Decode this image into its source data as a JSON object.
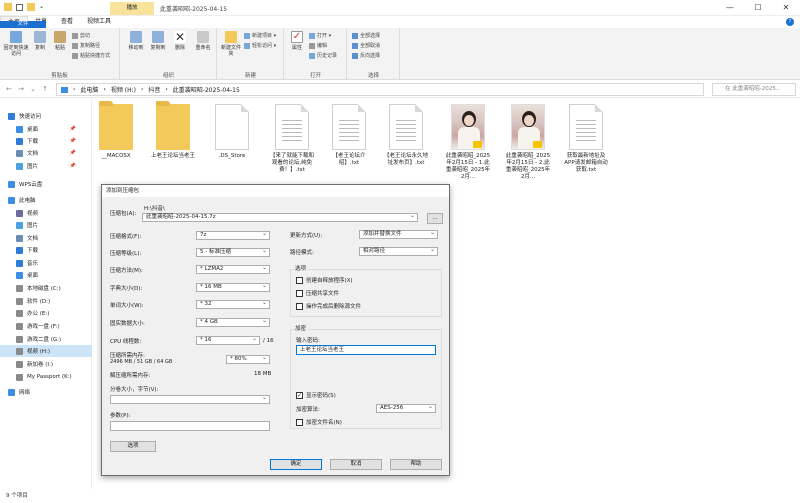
{
  "window": {
    "contextual_tab": "播放",
    "title": "此重袭昭昭-2025-04-15",
    "controls": {
      "minimize": "—",
      "maximize": "☐",
      "close": "✕"
    }
  },
  "tabs": [
    "文件",
    "主页",
    "共享",
    "查看",
    "视频工具"
  ],
  "ribbon": {
    "clipboard": {
      "label": "剪贴板",
      "pin": "固定到快速访问",
      "copy": "复制",
      "paste": "粘贴",
      "cut": "剪切",
      "copy_path": "复制路径",
      "paste_shortcut": "粘贴快捷方式"
    },
    "organize": {
      "label": "组织",
      "move_to": "移动到",
      "copy_to": "复制到",
      "delete": "删除",
      "rename": "重命名"
    },
    "new": {
      "label": "新建",
      "new_folder": "新建文件夹",
      "new_item": "新建项目 ▾",
      "easy_access": "轻松访问 ▾"
    },
    "open": {
      "label": "打开",
      "properties": "属性",
      "open": "打开 ▾",
      "edit": "编辑",
      "history": "历史记录"
    },
    "select": {
      "label": "选择",
      "select_all": "全部选择",
      "select_none": "全部取消",
      "invert": "反向选择"
    }
  },
  "address": {
    "crumbs": [
      "此电脑",
      "视频 (H:)",
      "抖音",
      "此重袭昭昭-2025-04-15"
    ],
    "search_placeholder": "在 此重袭昭昭-2025..."
  },
  "sidebar": [
    {
      "label": "快速访问",
      "icon": "star-icon",
      "color": "#2f7bd8"
    },
    {
      "label": "桌面",
      "icon": "desktop-icon",
      "color": "#3a8ee6",
      "pinned": true
    },
    {
      "label": "下载",
      "icon": "download-icon",
      "color": "#2f7bd8",
      "pinned": true
    },
    {
      "label": "文档",
      "icon": "document-icon",
      "color": "#6e8fb5",
      "pinned": true
    },
    {
      "label": "图片",
      "icon": "picture-icon",
      "color": "#4aa0e0",
      "pinned": true
    },
    {
      "label": "WPS云盘",
      "icon": "cloud-icon",
      "color": "#3a8ee6"
    },
    {
      "label": "此电脑",
      "icon": "computer-icon",
      "color": "#3a8ee6"
    },
    {
      "label": "视频",
      "icon": "video-icon",
      "color": "#6b6b9a"
    },
    {
      "label": "图片",
      "icon": "picture-icon",
      "color": "#4aa0e0"
    },
    {
      "label": "文档",
      "icon": "document-icon",
      "color": "#6e8fb5"
    },
    {
      "label": "下载",
      "icon": "download-icon",
      "color": "#2f7bd8"
    },
    {
      "label": "音乐",
      "icon": "music-icon",
      "color": "#2f7bd8"
    },
    {
      "label": "桌面",
      "icon": "desktop-icon",
      "color": "#3a8ee6"
    },
    {
      "label": "本地磁盘 (C:)",
      "icon": "drive-icon",
      "color": "#8a8a8a"
    },
    {
      "label": "软件 (D:)",
      "icon": "drive-icon",
      "color": "#8a8a8a"
    },
    {
      "label": "办公 (E:)",
      "icon": "drive-icon",
      "color": "#8a8a8a"
    },
    {
      "label": "游戏一盘 (F:)",
      "icon": "drive-icon",
      "color": "#8a8a8a"
    },
    {
      "label": "游戏二盘 (G:)",
      "icon": "drive-icon",
      "color": "#8a8a8a"
    },
    {
      "label": "视频 (H:)",
      "icon": "drive-icon",
      "color": "#8a8a8a",
      "selected": true
    },
    {
      "label": "新加卷 (I:)",
      "icon": "drive-icon",
      "color": "#8a8a8a"
    },
    {
      "label": "My Passport (K:)",
      "icon": "drive-icon",
      "color": "#8a8a8a"
    },
    {
      "label": "网络",
      "icon": "network-icon",
      "color": "#3a8ee6"
    }
  ],
  "files": [
    {
      "name": "__MACOSX",
      "type": "folder"
    },
    {
      "name": "上老王论坛当老王",
      "type": "folder"
    },
    {
      "name": ".DS_Store",
      "type": "doc"
    },
    {
      "name": "【来了就能下载和观看的论坛,纯免费！】.txt",
      "type": "txt"
    },
    {
      "name": "【老王论坛介绍】.txt",
      "type": "txt"
    },
    {
      "name": "【老王论坛永久地址发布页】.txt",
      "type": "txt"
    },
    {
      "name": "此重袭昭昭_2025年2月15日 - 1.此重袭昭昭_2025年2月...",
      "type": "photo"
    },
    {
      "name": "此重袭昭昭_2025年2月15日 - 2.此重袭昭昭_2025年2月...",
      "type": "photo"
    },
    {
      "name": "获取最新地址及APP请发邮箱自动获取.txt",
      "type": "txt"
    }
  ],
  "status": "9 个项目",
  "dialog": {
    "title": "添加到压缩包",
    "archive_label": "压缩包(A):",
    "archive_path": "H:\\抖音\\",
    "archive_name": "此重袭昭昭-2025-04-15.7z",
    "browse": "...",
    "left": [
      {
        "label": "压缩格式(F):",
        "value": "7z"
      },
      {
        "label": "压缩等级(L):",
        "value": "5 - 标准压缩"
      },
      {
        "label": "压缩方法(M):",
        "value": "* LZMA2"
      },
      {
        "label": "字典大小(D):",
        "value": "* 16 MB"
      },
      {
        "label": "单词大小(W):",
        "value": "* 32"
      },
      {
        "label": "固实数据大小:",
        "value": "* 4 GB"
      },
      {
        "label": "CPU 线程数:",
        "value": "* 16"
      }
    ],
    "threads_total": "/ 16",
    "mem_label": "压缩所需内存:",
    "mem_value": "2496 MB / 51 GB / 64 GB",
    "mem_percent": "* 80%",
    "decomp_label": "解压缩所需内存:",
    "decomp_value": "18 MB",
    "split_label": "分卷大小，字节(V):",
    "params_label": "参数(P):",
    "options_button": "选项",
    "update_label": "更新方式(U):",
    "update_value": "添加并替换文件",
    "path_label": "路径模式:",
    "path_value": "相对路径",
    "options_title": "选项",
    "options": [
      "创建自释放程序(X)",
      "压缩共享文件",
      "操作完成后删除源文件"
    ],
    "encrypt_title": "加密",
    "password_label": "输入密码:",
    "password_value": "上老王论坛当老王",
    "show_password": "显示密码(S)",
    "method_label": "加密算法:",
    "method_value": "AES-256",
    "encrypt_names": "加密文件名(N)",
    "ok": "确定",
    "cancel": "取消",
    "help": "帮助"
  }
}
